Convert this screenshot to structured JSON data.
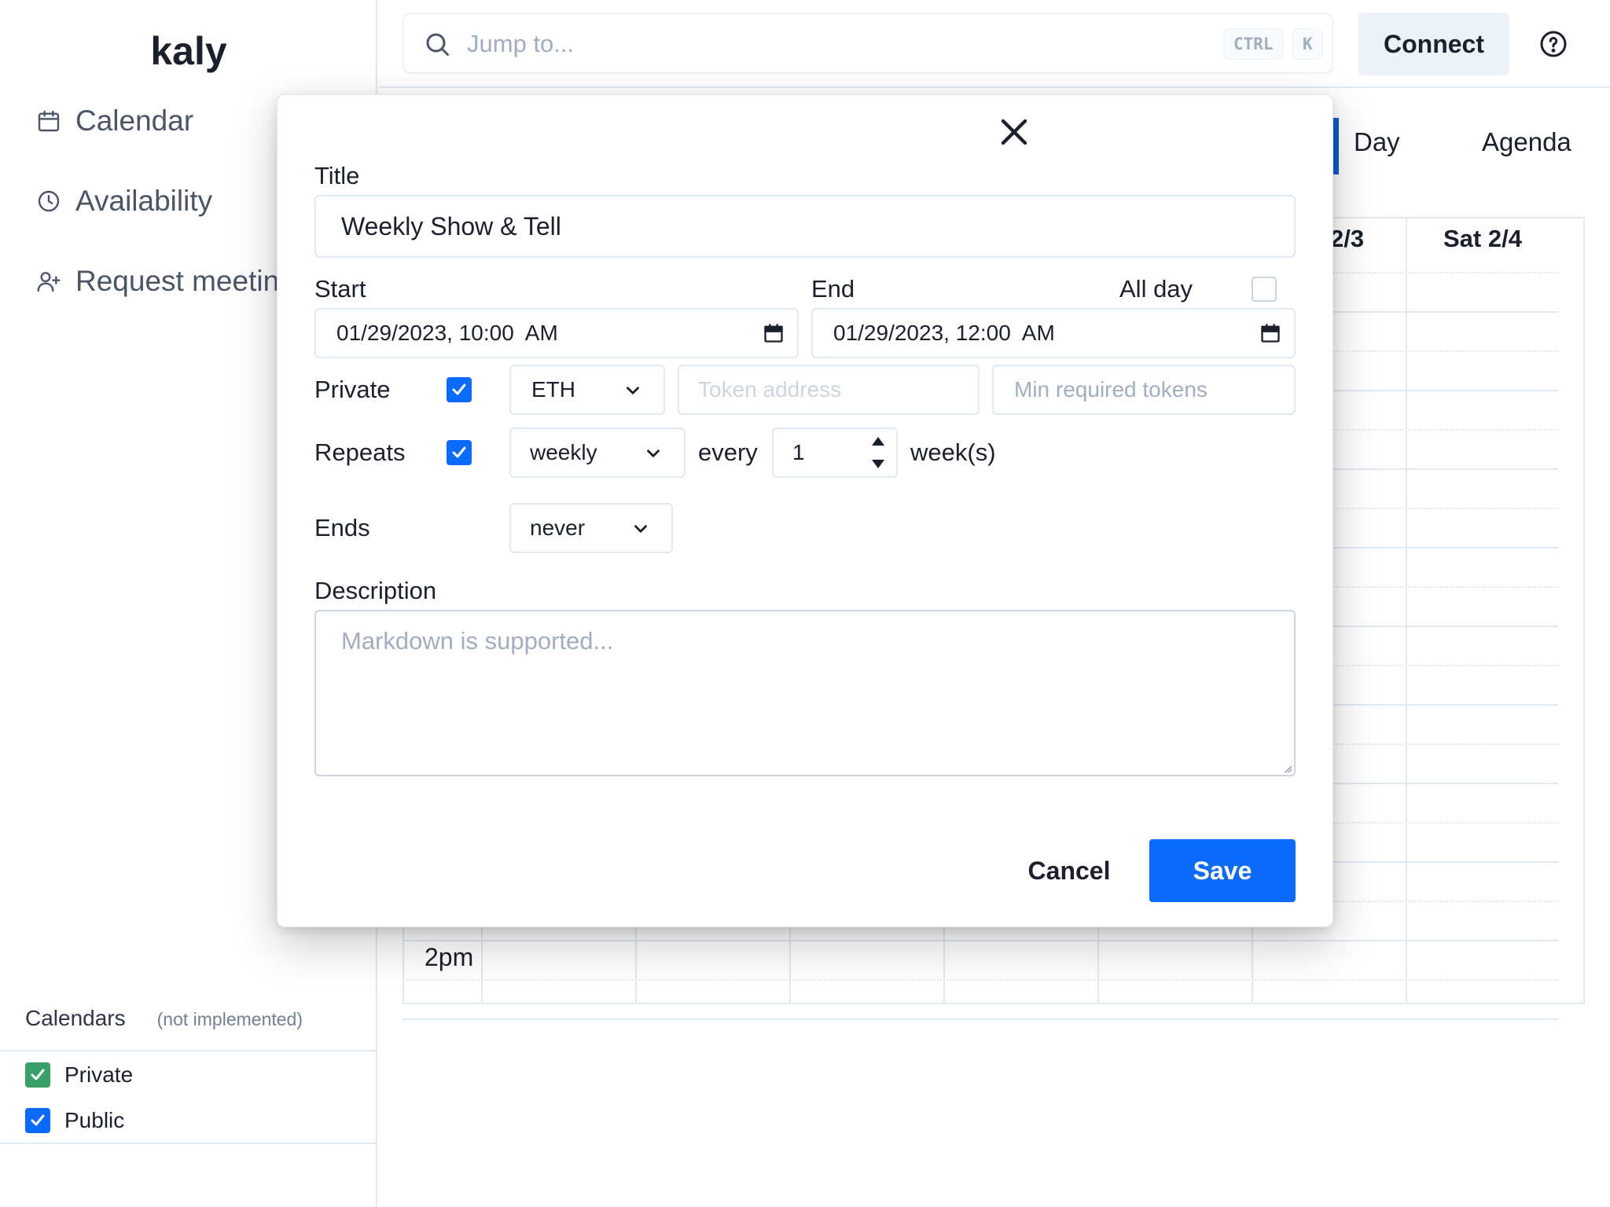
{
  "app": {
    "logo": "kaly"
  },
  "sidebar": {
    "items": [
      {
        "label": "Calendar",
        "icon": "calendar-icon"
      },
      {
        "label": "Availability",
        "icon": "clock-icon"
      },
      {
        "label": "Request meeting",
        "icon": "user-plus-icon"
      }
    ],
    "calendars_title": "Calendars",
    "calendars_note": "(not implemented)",
    "calendars": [
      {
        "label": "Private",
        "checked": true,
        "color": "#38a169"
      },
      {
        "label": "Public",
        "checked": true,
        "color": "#0b6bff"
      }
    ]
  },
  "topbar": {
    "search_placeholder": "Jump to...",
    "shortcut": [
      "CTRL",
      "K"
    ],
    "connect_label": "Connect"
  },
  "calendar": {
    "view_tabs": [
      "Day",
      "Agenda"
    ],
    "visible_day_headers": [
      "2/3",
      "Sat 2/4"
    ],
    "time_label": "2pm"
  },
  "modal": {
    "title_label": "Title",
    "title_value": "Weekly Show & Tell",
    "start_label": "Start",
    "start_value": "01/29/2023, 10:00  AM",
    "end_label": "End",
    "end_value": "01/29/2023, 12:00  AM",
    "allday_label": "All day",
    "allday_checked": false,
    "private_label": "Private",
    "private_checked": true,
    "token_select": "ETH",
    "token_address_placeholder": "Token address",
    "min_tokens_placeholder": "Min required tokens",
    "repeats_label": "Repeats",
    "repeats_checked": true,
    "repeat_freq": "weekly",
    "every_label": "every",
    "interval_value": "1",
    "interval_unit": "week(s)",
    "ends_label": "Ends",
    "ends_value": "never",
    "description_label": "Description",
    "description_placeholder": "Markdown is supported...",
    "cancel_label": "Cancel",
    "save_label": "Save"
  },
  "colors": {
    "accent": "#0b6bff",
    "private_green": "#38a169",
    "muted": "#a0aec0"
  }
}
